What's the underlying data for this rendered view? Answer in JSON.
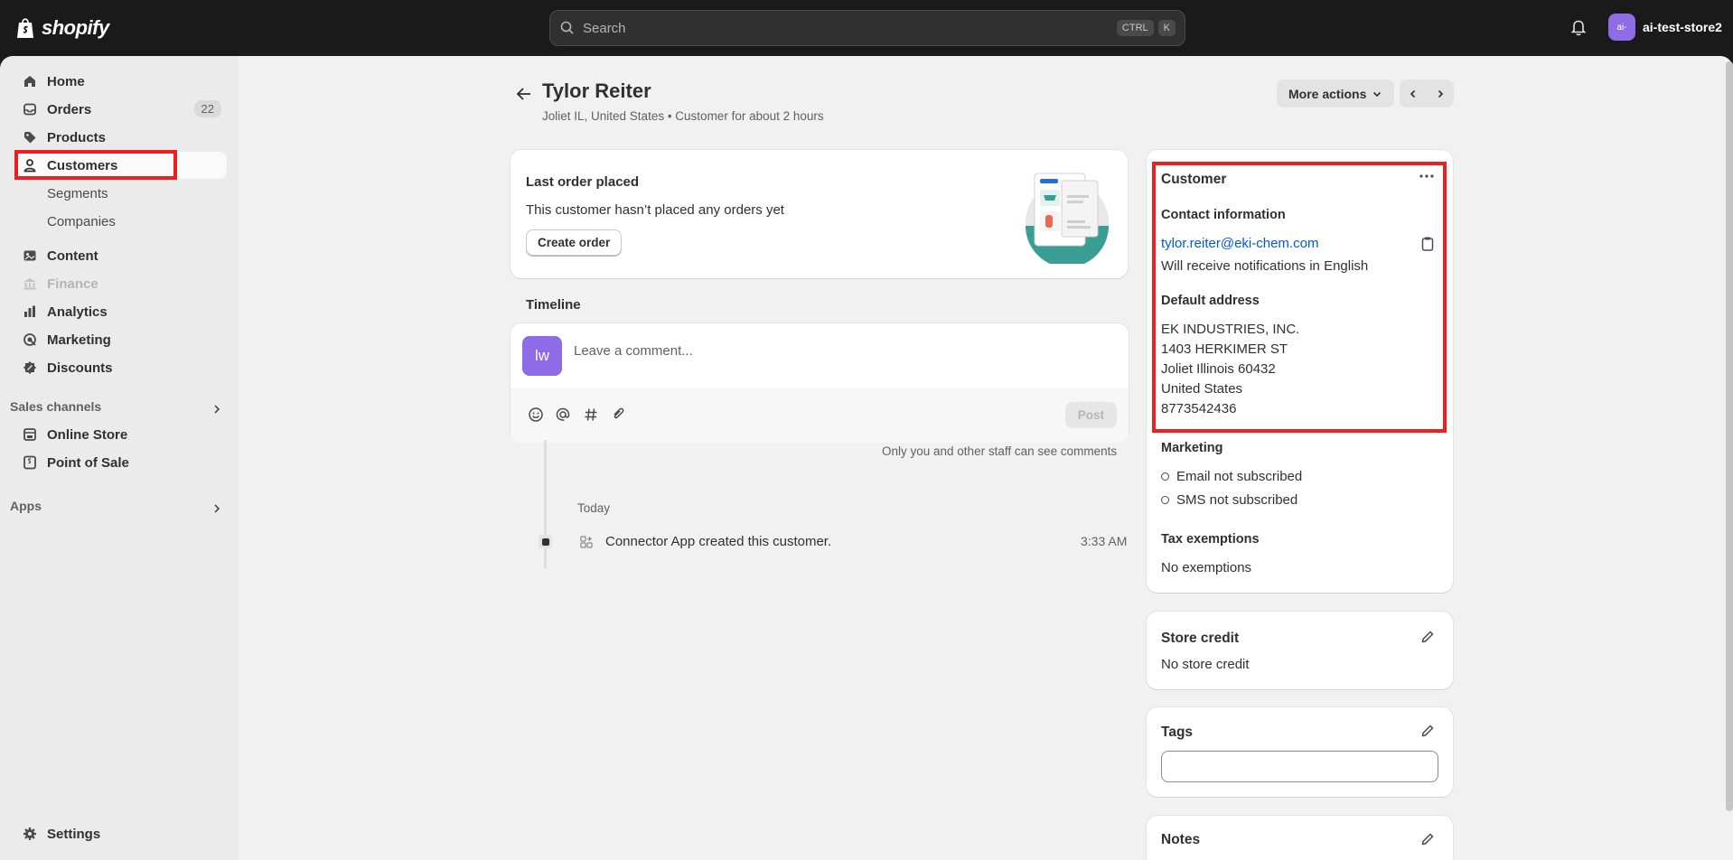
{
  "topbar": {
    "logo_text": "shopify",
    "search_placeholder": "Search",
    "shortcut_ctrl": "CTRL",
    "shortcut_k": "K",
    "store_avatar": "ai-",
    "store_name": "ai-test-store2"
  },
  "sidebar": {
    "home": "Home",
    "orders": "Orders",
    "orders_count": "22",
    "products": "Products",
    "customers": "Customers",
    "segments": "Segments",
    "companies": "Companies",
    "content": "Content",
    "finance": "Finance",
    "analytics": "Analytics",
    "marketing": "Marketing",
    "discounts": "Discounts",
    "sales_channels": "Sales channels",
    "online_store": "Online Store",
    "point_of_sale": "Point of Sale",
    "apps": "Apps",
    "settings": "Settings"
  },
  "header": {
    "title": "Tylor Reiter",
    "subtitle": "Joliet IL, United States • Customer for about 2 hours",
    "more_actions": "More actions"
  },
  "last_order": {
    "title": "Last order placed",
    "text": "This customer hasn’t placed any orders yet",
    "button": "Create order"
  },
  "timeline": {
    "label": "Timeline",
    "avatar_initials": "lw",
    "comment_placeholder": "Leave a comment...",
    "post_button": "Post",
    "visibility_note": "Only you and other staff can see comments",
    "day_label": "Today",
    "event_text": "Connector App created this customer.",
    "event_time": "3:33 AM"
  },
  "customer_card": {
    "title": "Customer",
    "contact_heading": "Contact information",
    "email": "tylor.reiter@eki-chem.com",
    "language_note": "Will receive notifications in English",
    "address_heading": "Default address",
    "address_lines": [
      "EK INDUSTRIES, INC.",
      "1403 HERKIMER ST",
      "Joliet Illinois 60432",
      "United States",
      "8773542436"
    ],
    "marketing_heading": "Marketing",
    "email_status": "Email not subscribed",
    "sms_status": "SMS not subscribed",
    "tax_heading": "Tax exemptions",
    "tax_value": "No exemptions"
  },
  "store_credit": {
    "title": "Store credit",
    "value": "No store credit"
  },
  "tags": {
    "title": "Tags",
    "value": ""
  },
  "notes": {
    "title": "Notes"
  },
  "colors": {
    "highlight": "#ef1f1f",
    "link": "#005bd3",
    "avatar": "#8f6be8"
  }
}
